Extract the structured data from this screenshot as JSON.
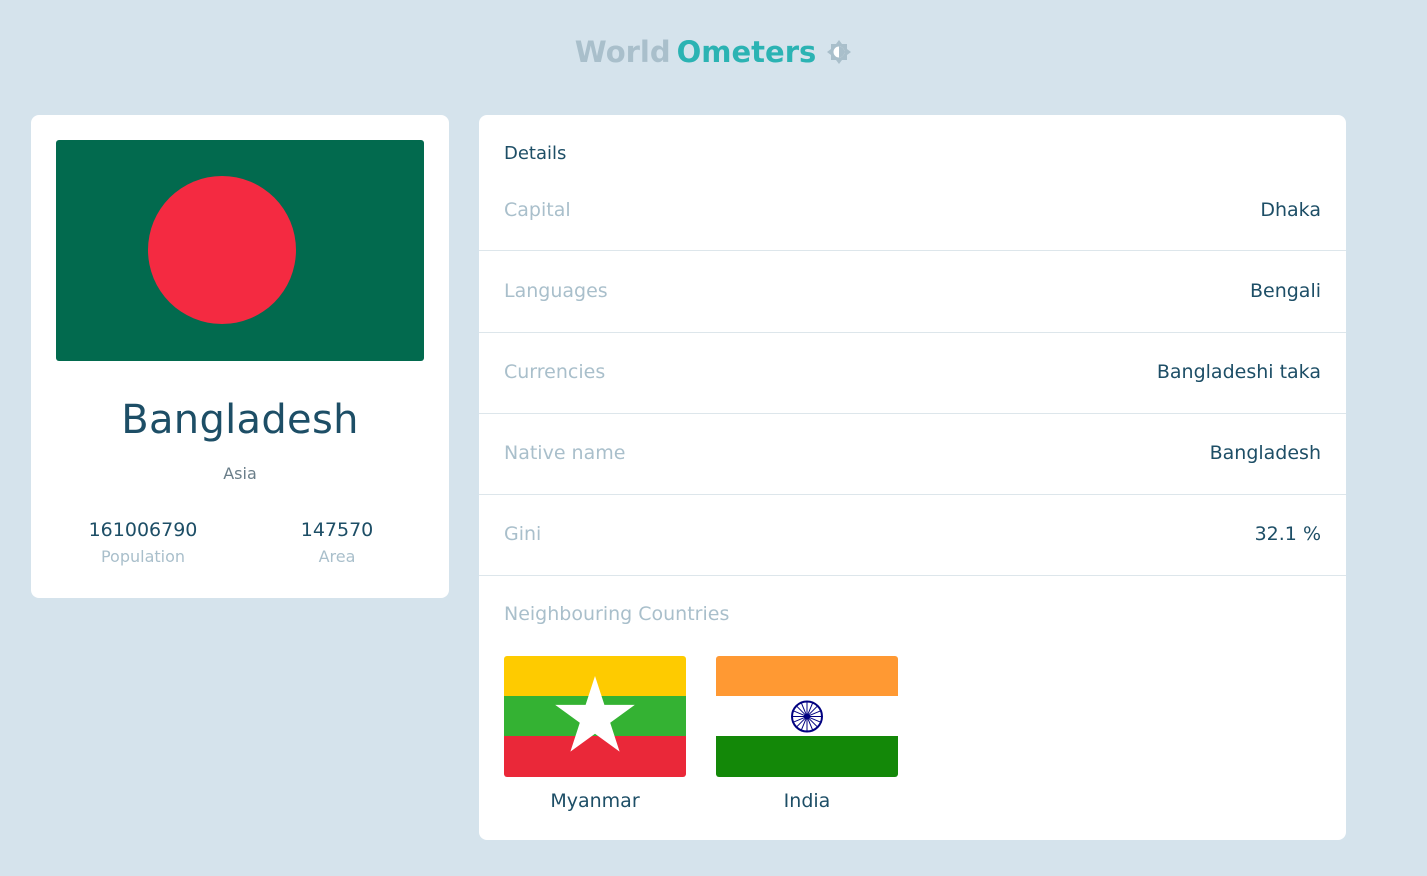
{
  "header": {
    "logo_word1": "World",
    "logo_word2": "Ometers",
    "theme_icon": "brightness-icon"
  },
  "country": {
    "name": "Bangladesh",
    "region": "Asia",
    "population_value": "161006790",
    "population_label": "Population",
    "area_value": "147570",
    "area_label": "Area",
    "flag_colors": {
      "field": "#026a4e",
      "disc": "#f42a41"
    }
  },
  "details": {
    "title": "Details",
    "rows": [
      {
        "label": "Capital",
        "value": "Dhaka"
      },
      {
        "label": "Languages",
        "value": "Bengali"
      },
      {
        "label": "Currencies",
        "value": "Bangladeshi taka"
      },
      {
        "label": "Native name",
        "value": "Bangladesh"
      },
      {
        "label": "Gini",
        "value": "32.1 %"
      }
    ]
  },
  "neighbours": {
    "title": "Neighbouring Countries",
    "items": [
      {
        "name": "Myanmar",
        "flag_colors": [
          "#fecb00",
          "#34b233",
          "#ea2839"
        ]
      },
      {
        "name": "India",
        "flag_colors": [
          "#ff9933",
          "#ffffff",
          "#138808"
        ]
      }
    ]
  },
  "colors": {
    "background": "#d5e3ec",
    "primary_text": "#1d4e66",
    "muted_text": "#a9bfcb",
    "accent": "#2bb3b3"
  }
}
